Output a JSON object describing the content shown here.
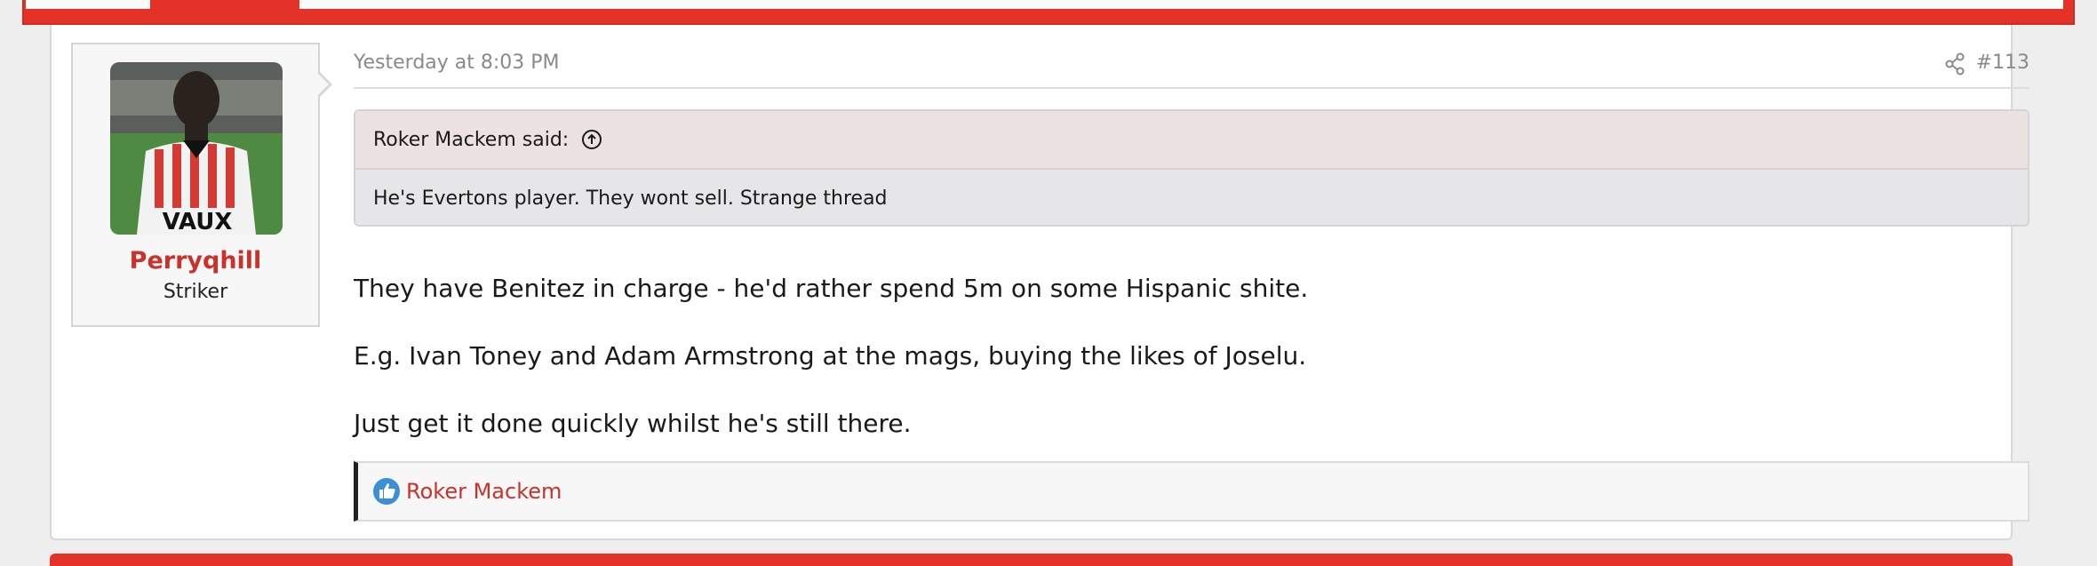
{
  "post": {
    "date": "Yesterday at 8:03 PM",
    "number": "#113",
    "share_icon": "share-icon"
  },
  "user": {
    "name": "Perryqhill",
    "title": "Striker",
    "avatar_shirt_text": "VAUX"
  },
  "quote": {
    "author_label": "Roker Mackem said:",
    "text": "He's Evertons player. They wont sell. Strange thread"
  },
  "body": {
    "paragraphs": [
      "They have Benitez in charge - he'd rather spend 5m on some Hispanic shite.",
      "E.g. Ivan Toney and Adam Armstrong at the mags, buying the likes of Joselu.",
      "Just get it done quickly whilst he's still there."
    ]
  },
  "reactions": {
    "icon": "like-icon",
    "users": "Roker Mackem"
  },
  "colors": {
    "accent": "#e53228",
    "username": "#c9322b",
    "like": "#3c8fd6"
  }
}
